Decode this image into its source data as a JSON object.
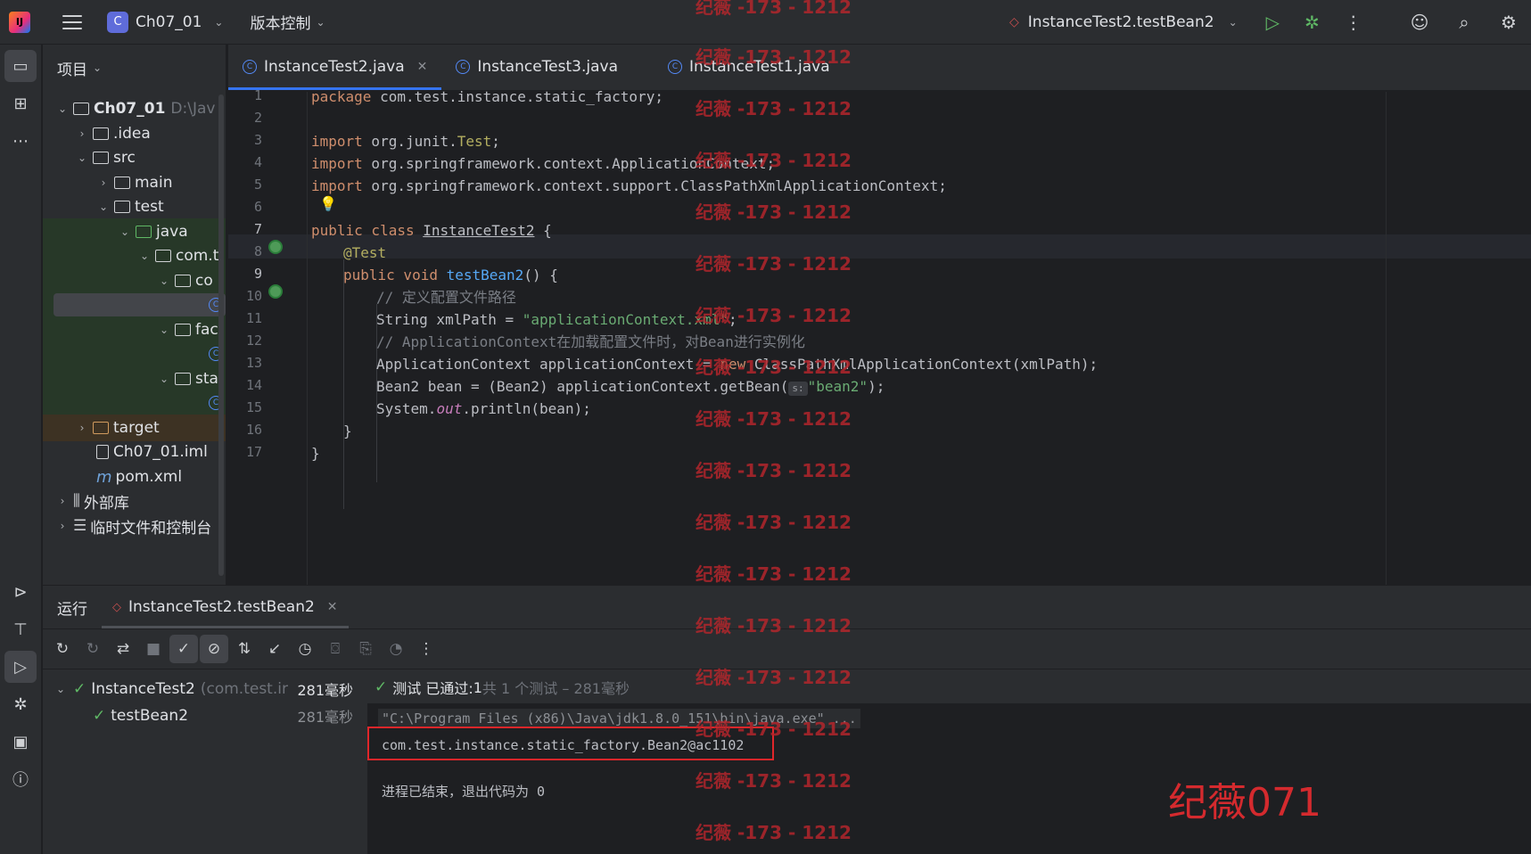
{
  "titlebar": {
    "project_badge": "C",
    "project_name": "Ch07_01",
    "vcs_menu": "版本控制",
    "run_config": "InstanceTest2.testBean2"
  },
  "project_panel": {
    "header": "项目",
    "tree": [
      {
        "label": "Ch07_01",
        "suffix": "D:\\Jav"
      },
      {
        "label": ".idea"
      },
      {
        "label": "src"
      },
      {
        "label": "main"
      },
      {
        "label": "test"
      },
      {
        "label": "java"
      },
      {
        "label": "com.t"
      },
      {
        "label": "co"
      },
      {
        "label": "fac"
      },
      {
        "label": "sta"
      },
      {
        "label": "target"
      },
      {
        "label": "Ch07_01.iml"
      },
      {
        "label": "pom.xml"
      },
      {
        "label": "外部库"
      },
      {
        "label": "临时文件和控制台"
      }
    ]
  },
  "editor": {
    "tabs": [
      {
        "label": "InstanceTest2.java",
        "active": true
      },
      {
        "label": "InstanceTest3.java",
        "active": false
      },
      {
        "label": "InstanceTest1.java",
        "active": false
      }
    ],
    "line_numbers": [
      "1",
      "2",
      "3",
      "4",
      "5",
      "6",
      "7",
      "8",
      "9",
      "10",
      "11",
      "12",
      "13",
      "14",
      "15",
      "16",
      "17"
    ],
    "code": {
      "l1_kw": "package",
      "l1_rest": " com.test.instance.static_factory;",
      "l3_kw": "import",
      "l3_pkg": " org.junit.",
      "l3_cls": "Test",
      "l3_end": ";",
      "l4_kw": "import",
      "l4_rest": " org.springframework.context.ApplicationContext;",
      "l5_kw": "import",
      "l5_rest": " org.springframework.context.support.ClassPathXmlApplicationContext;",
      "l7_kw": "public class",
      "l7_cls": "InstanceTest2",
      "l7_end": " {",
      "l8_ann": "@Test",
      "l9_kw": "public void",
      "l9_fn": "testBean2",
      "l9_end": "() {",
      "l10_cm": "// 定义配置文件路径",
      "l11_pre": "String xmlPath = ",
      "l11_str": "\"applicationContext.xml\"",
      "l11_end": ";",
      "l12_cm": "// ApplicationContext在加载配置文件时，对Bean进行实例化",
      "l13_pre": "ApplicationContext applicationContext = ",
      "l13_kw": "new",
      "l13_end": " ClassPathXmlApplicationContext(xmlPath);",
      "l14_pre": "Bean2 bean = (Bean2) applicationContext.getBean(",
      "l14_hint": "s:",
      "l14_str": "\"bean2\"",
      "l14_end": ");",
      "l15_pre": "System.",
      "l15_ital": "out",
      "l15_end": ".println(bean);",
      "l16": "}",
      "l17": "}"
    }
  },
  "run_panel": {
    "tab_run": "运行",
    "tab_config": "InstanceTest2.testBean2",
    "tests": [
      {
        "name": "InstanceTest2",
        "suffix": "(com.test.ir",
        "time": "281毫秒"
      },
      {
        "name": "testBean2",
        "time": "281毫秒"
      }
    ],
    "status_prefix": "测试 已通过: ",
    "status_count": "1",
    "status_suffix": "共 1 个测试 – 281毫秒",
    "console": {
      "cmd": "\"C:\\Program Files (x86)\\Java\\jdk1.8.0_151\\bin\\java.exe\" ...",
      "output": "com.test.instance.static_factory.Bean2@ac1102",
      "exit": "进程已结束，退出代码为 0"
    }
  },
  "watermark": {
    "small": "纪薇 -173 - 1212",
    "big": "纪薇071",
    "color": "#b3262c"
  }
}
